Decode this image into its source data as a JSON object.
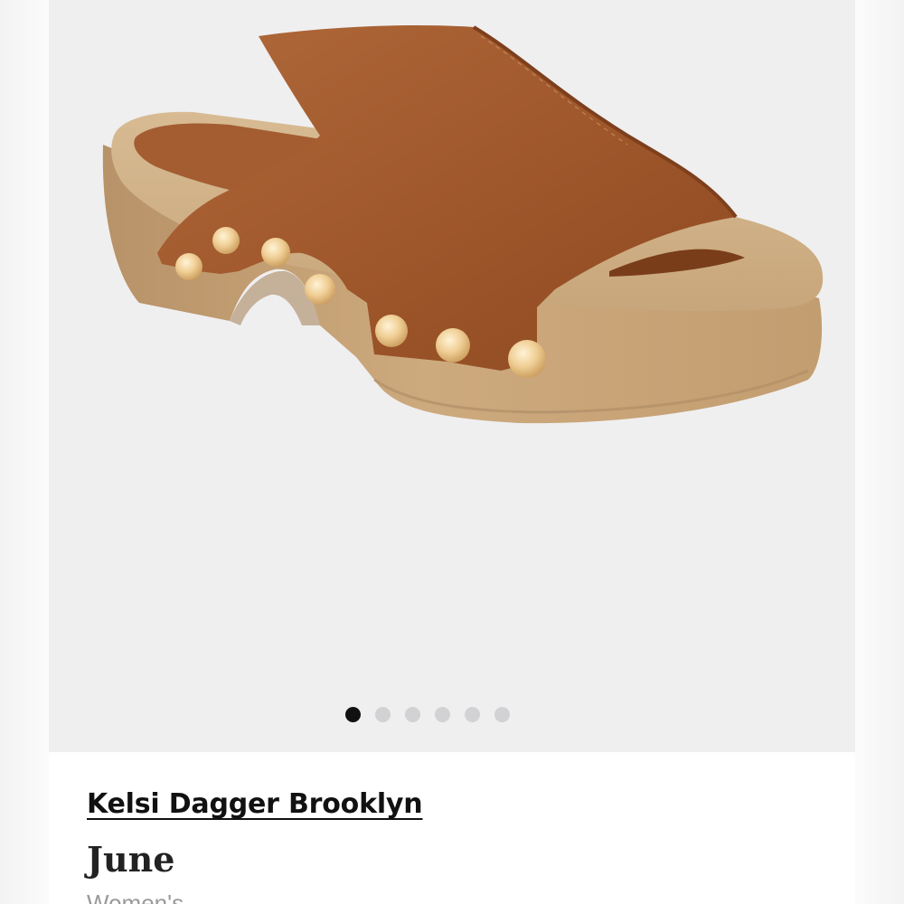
{
  "gallery": {
    "image_alt": "Brown suede clog slide sandal with gold studs",
    "page_indicator": {
      "count": 6,
      "active_index": 0
    }
  },
  "product": {
    "brand": "Kelsi Dagger Brooklyn",
    "name": "June",
    "category": "Women's"
  },
  "colors": {
    "suede": "#a0582c",
    "wood": "#c9a57a",
    "stud": "#e8c48a",
    "active_dot": "#111111",
    "inactive_dot": "#d2d2d4"
  }
}
